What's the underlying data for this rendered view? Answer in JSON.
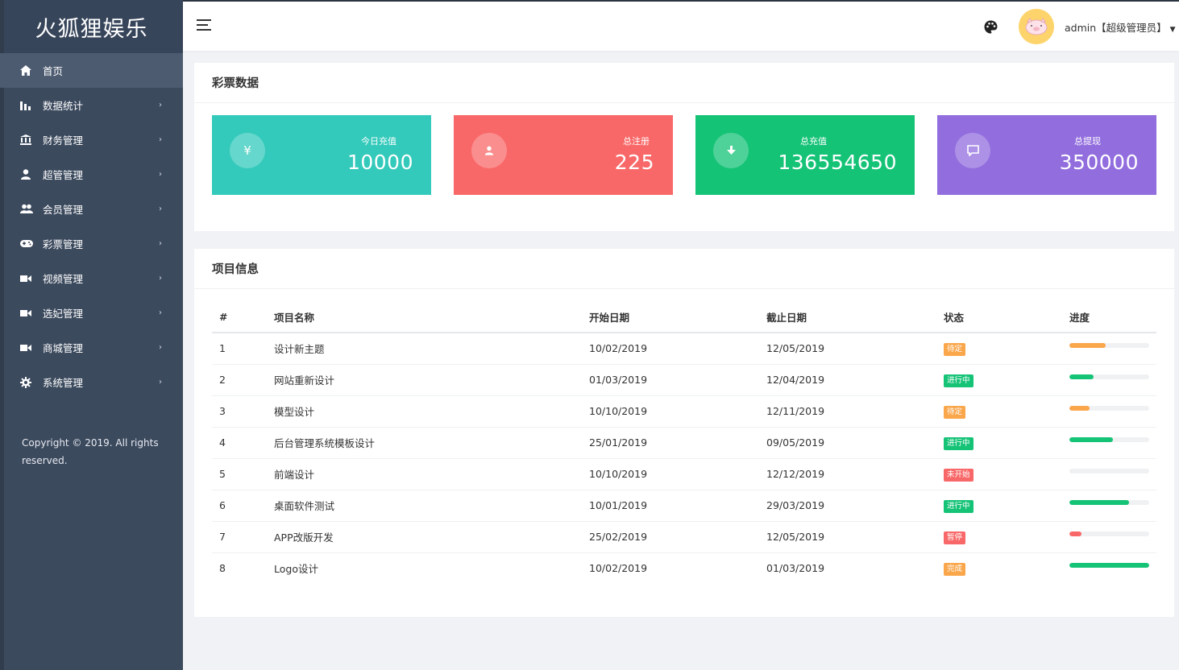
{
  "brand": "火狐狸娱乐",
  "sidebar": {
    "items": [
      {
        "label": "首页",
        "icon": "home-icon"
      },
      {
        "label": "数据统计",
        "icon": "bar-chart-icon"
      },
      {
        "label": "财务管理",
        "icon": "bank-icon"
      },
      {
        "label": "超管管理",
        "icon": "user-icon"
      },
      {
        "label": "会员管理",
        "icon": "users-icon"
      },
      {
        "label": "彩票管理",
        "icon": "gamepad-icon"
      },
      {
        "label": "视频管理",
        "icon": "video-icon"
      },
      {
        "label": "选妃管理",
        "icon": "video-icon"
      },
      {
        "label": "商城管理",
        "icon": "video-icon"
      },
      {
        "label": "系统管理",
        "icon": "gear-icon"
      }
    ],
    "copyright": "Copyright © 2019. All rights reserved."
  },
  "header": {
    "user": "admin【超级管理员】"
  },
  "stats": {
    "title": "彩票数据",
    "cards": [
      {
        "label": "今日充值",
        "value": "10000",
        "icon_glyph": "¥",
        "color": "#33cabb"
      },
      {
        "label": "总注册",
        "value": "225",
        "icon_glyph": "user-icon",
        "color": "#f96868"
      },
      {
        "label": "总充值",
        "value": "136554650",
        "icon_glyph": "download-icon",
        "color": "#15c377"
      },
      {
        "label": "总提现",
        "value": "350000",
        "icon_glyph": "comment-icon",
        "color": "#926dde"
      }
    ]
  },
  "projects": {
    "title": "项目信息",
    "headers": [
      "#",
      "项目名称",
      "开始日期",
      "截止日期",
      "状态",
      "进度"
    ],
    "rows": [
      {
        "id": "1",
        "name": "设计新主题",
        "start": "10/02/2019",
        "end": "12/05/2019",
        "status": "待定",
        "status_color": "#faa64b",
        "progress": 0.45,
        "bar_color": "#faa64b"
      },
      {
        "id": "2",
        "name": "网站重新设计",
        "start": "01/03/2019",
        "end": "12/04/2019",
        "status": "进行中",
        "status_color": "#15c377",
        "progress": 0.3,
        "bar_color": "#15c377"
      },
      {
        "id": "3",
        "name": "模型设计",
        "start": "10/10/2019",
        "end": "12/11/2019",
        "status": "待定",
        "status_color": "#faa64b",
        "progress": 0.25,
        "bar_color": "#faa64b"
      },
      {
        "id": "4",
        "name": "后台管理系统模板设计",
        "start": "25/01/2019",
        "end": "09/05/2019",
        "status": "进行中",
        "status_color": "#15c377",
        "progress": 0.55,
        "bar_color": "#15c377"
      },
      {
        "id": "5",
        "name": "前端设计",
        "start": "10/10/2019",
        "end": "12/12/2019",
        "status": "未开始",
        "status_color": "#f96868",
        "progress": 0.0,
        "bar_color": "#f96868"
      },
      {
        "id": "6",
        "name": "桌面软件测试",
        "start": "10/01/2019",
        "end": "29/03/2019",
        "status": "进行中",
        "status_color": "#15c377",
        "progress": 0.75,
        "bar_color": "#15c377"
      },
      {
        "id": "7",
        "name": "APP改版开发",
        "start": "25/02/2019",
        "end": "12/05/2019",
        "status": "暂停",
        "status_color": "#f96868",
        "progress": 0.15,
        "bar_color": "#f96868"
      },
      {
        "id": "8",
        "name": "Logo设计",
        "start": "10/02/2019",
        "end": "01/03/2019",
        "status": "完成",
        "status_color": "#faa64b",
        "progress": 1.0,
        "bar_color": "#15c377"
      }
    ]
  }
}
